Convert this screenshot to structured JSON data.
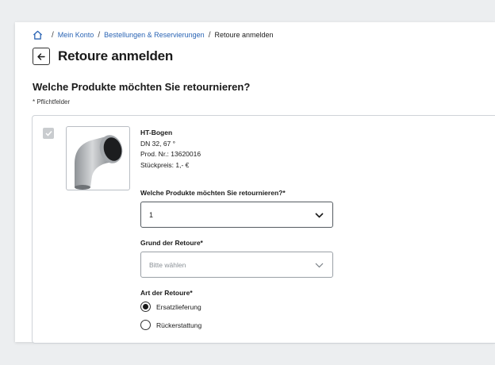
{
  "breadcrumb": {
    "home_icon": "home-icon",
    "items": [
      "Mein Konto",
      "Bestellungen & Reservierungen"
    ],
    "current": "Retoure anmelden",
    "separator": "/"
  },
  "header": {
    "title": "Retoure anmelden",
    "back_icon": "arrow-left-icon"
  },
  "section": {
    "title": "Welche Produkte möchten Sie retournieren?",
    "required_note": "* Pflichtfelder"
  },
  "product": {
    "selected": true,
    "name": "HT-Bogen",
    "spec": "DN 32, 67 °",
    "prod_nr": "Prod. Nr.: 13620016",
    "price": "Stückpreis: 1,- €"
  },
  "form": {
    "quantity_label": "Welche Produkte möchten Sie retournieren?*",
    "quantity_value": "1",
    "reason_label": "Grund der Retoure*",
    "reason_placeholder": "Bitte wählen",
    "type_label": "Art der Retoure*",
    "type_options": [
      {
        "label": "Ersatzlieferung",
        "selected": true
      },
      {
        "label": "Rückerstattung",
        "selected": false
      }
    ]
  },
  "colors": {
    "link": "#2a64b4",
    "checkbox_disabled": "#c9cccf",
    "border": "#cfd3d8"
  }
}
